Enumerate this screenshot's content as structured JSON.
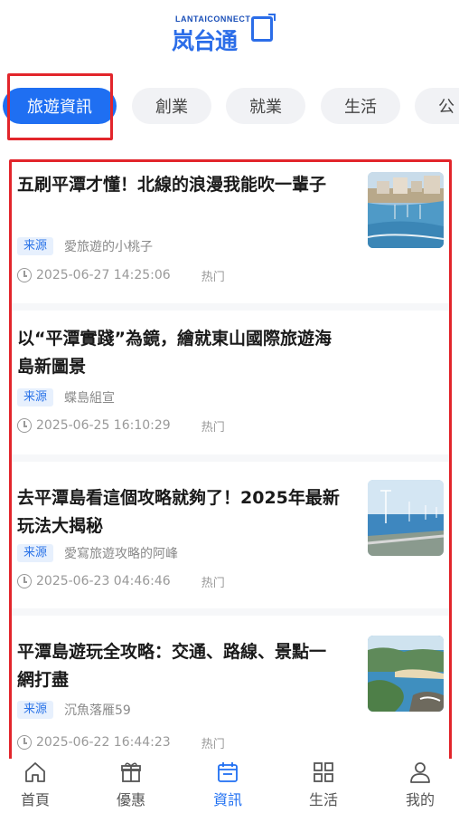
{
  "header": {
    "logo_en": "LANTAICONNECT",
    "logo_cn": "岚台通"
  },
  "tabs": [
    {
      "label": "旅遊資訊",
      "active": true
    },
    {
      "label": "創業",
      "active": false
    },
    {
      "label": "就業",
      "active": false
    },
    {
      "label": "生活",
      "active": false
    },
    {
      "label": "公",
      "active": false
    }
  ],
  "articles": [
    {
      "title": "五刷平潭才懂！北線的浪漫我能吹一輩子",
      "source_badge": "来源",
      "source": "愛旅遊的小桃子",
      "time": "2025-06-27 14:25:06",
      "tag": "热门",
      "has_thumb": true
    },
    {
      "title": "以“平潭實踐”為鏡，繪就東山國際旅遊海島新圖景",
      "source_badge": "来源",
      "source": "蝶島組宣",
      "time": "2025-06-25 16:10:29",
      "tag": "热门",
      "has_thumb": false
    },
    {
      "title": "去平潭島看這個攻略就夠了！2025年最新玩法大揭秘",
      "source_badge": "来源",
      "source": "愛寫旅遊攻略的阿峰",
      "time": "2025-06-23 04:46:46",
      "tag": "热门",
      "has_thumb": true
    },
    {
      "title": "平潭島遊玩全攻略：交通、路線、景點一網打盡",
      "source_badge": "来源",
      "source": "沉魚落雁59",
      "time": "2025-06-22 16:44:23",
      "tag": "热门",
      "has_thumb": true
    }
  ],
  "bottom_nav": [
    {
      "label": "首頁",
      "icon": "home-icon",
      "active": false
    },
    {
      "label": "優惠",
      "icon": "gift-icon",
      "active": false
    },
    {
      "label": "資訊",
      "icon": "calendar-icon",
      "active": true
    },
    {
      "label": "生活",
      "icon": "grid-icon",
      "active": false
    },
    {
      "label": "我的",
      "icon": "user-icon",
      "active": false
    }
  ],
  "colors": {
    "accent": "#1f6ff2",
    "highlight_frame": "#e2252b"
  }
}
